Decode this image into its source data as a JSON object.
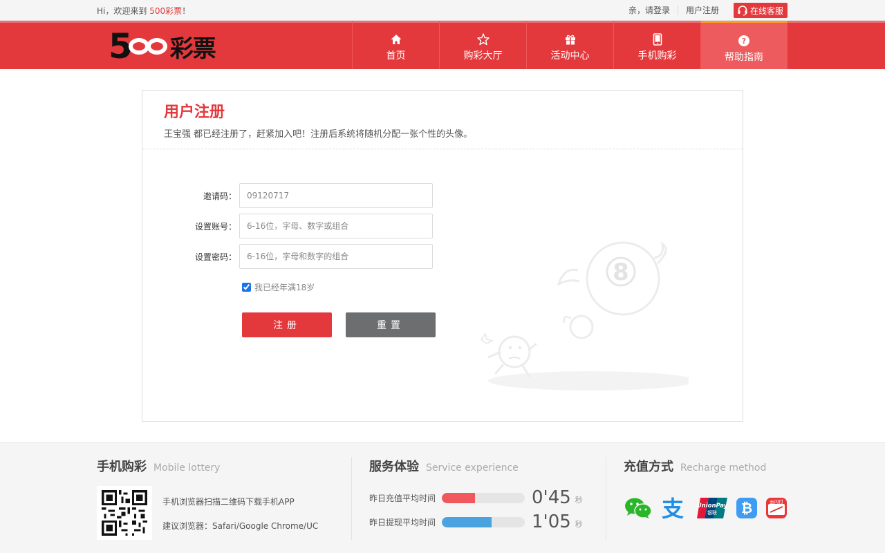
{
  "topbar": {
    "welcome_prefix": "Hi，欢迎来到 ",
    "welcome_brand": "500彩票",
    "welcome_suffix": "！",
    "login": "亲，请登录",
    "register": "用户注册",
    "customer_service": "在线客服"
  },
  "header": {
    "logo_number": "5",
    "logo_text": "彩票",
    "nav": [
      {
        "label": "首页",
        "icon": "home-icon"
      },
      {
        "label": "购彩大厅",
        "icon": "star-icon"
      },
      {
        "label": "活动中心",
        "icon": "gift-icon"
      },
      {
        "label": "手机购彩",
        "icon": "mobile-icon"
      },
      {
        "label": "帮助指南",
        "icon": "help-icon"
      }
    ]
  },
  "register": {
    "title": "用户注册",
    "subtitle": "王宝强 都已经注册了，赶紧加入吧！注册后系统将随机分配一张个性的头像。",
    "invite_label": "邀请码：",
    "invite_placeholder": "09120717",
    "account_label": "设置账号：",
    "account_placeholder": "6-16位，字母、数字或组合",
    "password_label": "设置密码：",
    "password_placeholder": "6-16位，字母和数字的组合",
    "agree_label": "我已经年满18岁",
    "agree_checked": true,
    "submit": "注册",
    "reset": "重置"
  },
  "footer": {
    "mobile": {
      "title_cn": "手机购彩",
      "title_en": "Mobile lottery",
      "line1": "手机浏览器扫描二维码下载手机APP",
      "line2": "建议浏览器：Safari/Google Chrome/UC"
    },
    "service": {
      "title_cn": "服务体验",
      "title_en": "Service experience",
      "recharge_label": "昨日充值平均时间",
      "recharge_value": "0'45",
      "recharge_fill": 0.4,
      "withdraw_label": "昨日提现平均时间",
      "withdraw_value": "1'05",
      "withdraw_fill": 0.6,
      "unit": "秒"
    },
    "recharge": {
      "title_cn": "充值方式",
      "title_en": "Recharge method",
      "unionpay_en": "UnionPay",
      "unionpay_cn": "银联",
      "cloudpay": "云闪付",
      "alipay_glyph": "支",
      "bitcoin_glyph": "₿"
    }
  },
  "colors": {
    "brand_red": "#e4393c",
    "active_tab": "#ee5b5e",
    "accent_orange": "#ff9a2e",
    "reset_gray": "#6d6e70",
    "bar_red": "#f0585b",
    "bar_blue": "#4aa3df"
  }
}
